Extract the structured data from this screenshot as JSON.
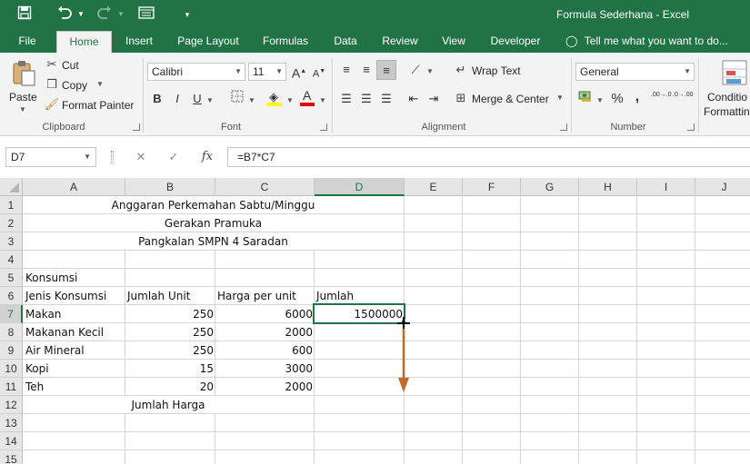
{
  "app": {
    "window_title": "Formula Sederhana - Excel"
  },
  "tabs": [
    "File",
    "Home",
    "Insert",
    "Page Layout",
    "Formulas",
    "Data",
    "Review",
    "View",
    "Developer"
  ],
  "tell_me": "Tell me what you want to do...",
  "ribbon": {
    "clipboard": {
      "paste": "Paste",
      "cut": "Cut",
      "copy": "Copy",
      "format_painter": "Format Painter",
      "label": "Clipboard"
    },
    "font": {
      "name": "Calibri",
      "size": "11",
      "bold": "B",
      "italic": "I",
      "underline": "U",
      "label": "Font",
      "font_color": "#e00000",
      "highlight_color": "#ffff00"
    },
    "alignment": {
      "wrap_text": "Wrap Text",
      "merge_center": "Merge & Center",
      "label": "Alignment"
    },
    "number": {
      "format": "General",
      "percent": "%",
      "comma": ",",
      "label": "Number",
      "dec_inc": ".00→.0",
      "dec_dec": ".0→.00"
    },
    "styles": {
      "conditional_line1": "Conditio",
      "conditional_line2": "Formattin"
    }
  },
  "formula_bar": {
    "name_box": "D7",
    "formula": "=B7*C7",
    "fx": "fx"
  },
  "columns": [
    "A",
    "B",
    "C",
    "D",
    "E",
    "F",
    "G",
    "H",
    "I",
    "J"
  ],
  "rows": [
    "1",
    "2",
    "3",
    "4",
    "5",
    "6",
    "7",
    "8",
    "9",
    "10",
    "11",
    "12",
    "13",
    "14",
    "15"
  ],
  "sheet": {
    "title1": "Anggaran Perkemahan Sabtu/Minggu",
    "title2": "Gerakan Pramuka",
    "title3": "Pangkalan SMPN 4 Saradan",
    "section": "Konsumsi",
    "headers": [
      "Jenis Konsumsi",
      "Jumlah Unit",
      "Harga per unit",
      "Jumlah"
    ],
    "items": [
      {
        "name": "Makan",
        "unit": "250",
        "price": "6000",
        "total": "1500000"
      },
      {
        "name": "Makanan Kecil",
        "unit": "250",
        "price": "2000",
        "total": ""
      },
      {
        "name": "Air Mineral",
        "unit": "250",
        "price": "600",
        "total": ""
      },
      {
        "name": "Kopi",
        "unit": "15",
        "price": "3000",
        "total": ""
      },
      {
        "name": "Teh",
        "unit": "20",
        "price": "2000",
        "total": ""
      }
    ],
    "jumlah_harga": "Jumlah Harga"
  },
  "annotation": {
    "arrow_color": "#c0692a"
  }
}
